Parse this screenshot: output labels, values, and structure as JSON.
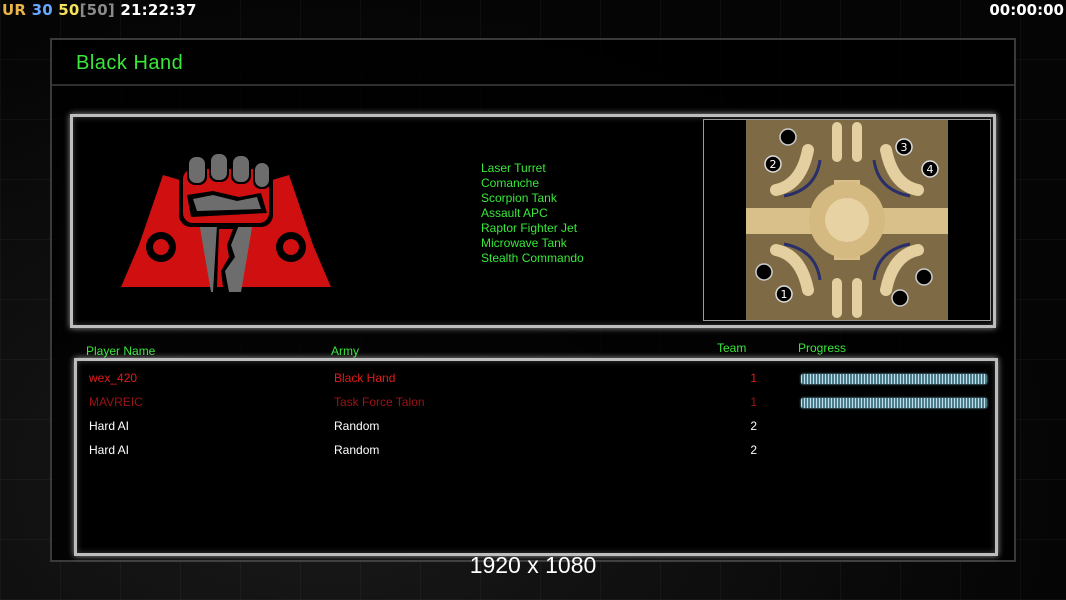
{
  "hud": {
    "ur": "UR",
    "n1": "30",
    "n2": "50",
    "n3": "[50]",
    "clock": "21:22:37",
    "timer": "00:00:00"
  },
  "title": "Black Hand",
  "units": [
    "Laser Turret",
    "Comanche",
    "Scorpion Tank",
    "Assault APC",
    "Raptor Fighter Jet",
    "Microwave Tank",
    "Stealth Commando"
  ],
  "map": {
    "start_positions": [
      "1",
      "2",
      "3",
      "4"
    ]
  },
  "table": {
    "headers": {
      "name": "Player Name",
      "army": "Army",
      "team": "Team",
      "progress": "Progress"
    },
    "rows": [
      {
        "name": "wex_420",
        "army": "Black Hand",
        "team": "1",
        "progress": 1.0,
        "color": "#e01b1b"
      },
      {
        "name": "MAVREIC",
        "army": "Task Force Talon",
        "team": "1",
        "progress": 1.0,
        "color": "#9e1313"
      },
      {
        "name": "Hard AI",
        "army": "Random",
        "team": "2",
        "color": "#ffffff"
      },
      {
        "name": "Hard AI",
        "army": "Random",
        "team": "2",
        "color": "#ffffff"
      }
    ]
  },
  "resolution": "1920 x 1080",
  "colors": {
    "accent": "#39e83a",
    "player1": "#e01b1b",
    "player2": "#9e1313"
  }
}
